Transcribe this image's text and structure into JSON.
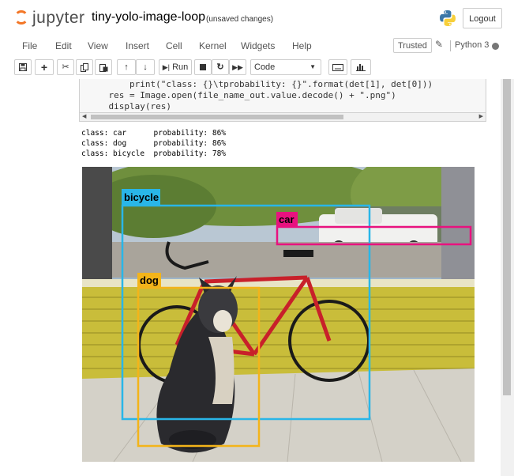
{
  "header": {
    "logo_text": "jupyter",
    "notebook_title": "tiny-yolo-image-loop",
    "save_status": "(unsaved changes)",
    "logout_label": "Logout"
  },
  "menubar": {
    "items": [
      "File",
      "Edit",
      "View",
      "Insert",
      "Cell",
      "Kernel",
      "Widgets",
      "Help"
    ],
    "trusted_label": "Trusted",
    "kernel_name": "Python 3"
  },
  "toolbar": {
    "run_label": "Run",
    "cell_type": "Code"
  },
  "code_cell": {
    "lines": [
      "        print(\"class: {}\\tprobability: {}\".format(det[1], det[0]))",
      "    res = Image.open(file_name_out.value.decode() + \".png\")",
      "    display(res)"
    ]
  },
  "output": {
    "lines": [
      "class: car      probability: 86%",
      "class: dog      probability: 86%",
      "class: bicycle  probability: 78%"
    ]
  },
  "detections": [
    {
      "label": "bicycle",
      "color": "#29b6e8"
    },
    {
      "label": "car",
      "color": "#e8127f"
    },
    {
      "label": "dog",
      "color": "#f3b41a"
    }
  ],
  "colors": {
    "jupyter_orange": "#f37626",
    "bicycle_box": "#29b6e8",
    "car_box": "#e8127f",
    "dog_box": "#f3b41a"
  }
}
